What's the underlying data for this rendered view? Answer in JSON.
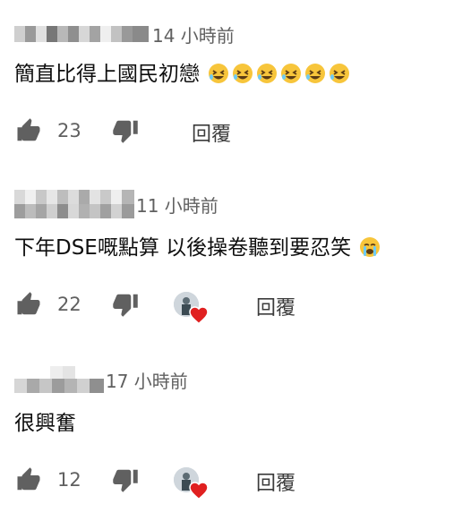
{
  "colors": {
    "text": "#0f0f0f",
    "secondary": "#606060",
    "heart": "#e02020"
  },
  "comments": [
    {
      "time": "14 小時前",
      "text": "簡直比得上國民初戀",
      "emoji_count": 6,
      "emoji_icon": "rofl-emoji-icon",
      "likes": "23",
      "reply_label": "回覆",
      "creator_heart": false
    },
    {
      "time": "11 小時前",
      "text": "下年DSE嘅點算 以後操卷聽到要忍笑",
      "emoji_count": 1,
      "emoji_icon": "crying-emoji-icon",
      "likes": "22",
      "reply_label": "回覆",
      "creator_heart": true
    },
    {
      "time": "17 小時前",
      "text": "很興奮",
      "emoji_count": 0,
      "likes": "12",
      "reply_label": "回覆",
      "creator_heart": true
    }
  ]
}
